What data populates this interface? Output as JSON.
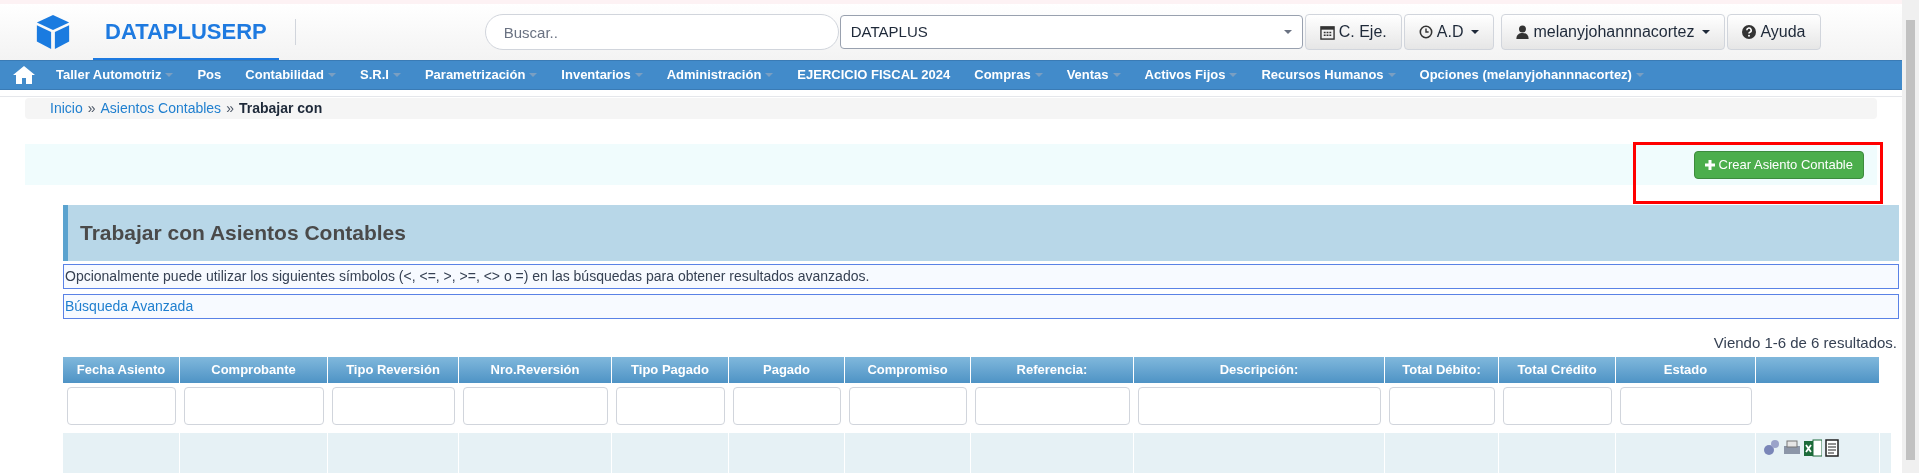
{
  "header": {
    "brand": "DATAPLUSERP",
    "search": {
      "placeholder": "Buscar.."
    },
    "company_select": {
      "value": "DATAPLUS"
    },
    "buttons": [
      {
        "kind": "calendar",
        "label": "C. Eje.",
        "dropdown": false
      },
      {
        "kind": "clock",
        "label": "A.D",
        "dropdown": true
      },
      {
        "kind": "user",
        "label": "melanyjohannnacortez",
        "dropdown": true
      },
      {
        "kind": "help",
        "label": "Ayuda",
        "dropdown": false
      }
    ]
  },
  "nav": {
    "items": [
      {
        "label": "Taller Automotriz",
        "dropdown": true
      },
      {
        "label": "Pos",
        "dropdown": false
      },
      {
        "label": "Contabilidad",
        "dropdown": true
      },
      {
        "label": "S.R.I",
        "dropdown": true
      },
      {
        "label": "Parametrización",
        "dropdown": true
      },
      {
        "label": "Inventarios",
        "dropdown": true
      },
      {
        "label": "Administración",
        "dropdown": true
      },
      {
        "label": "EJERCICIO FISCAL 2024",
        "dropdown": false
      },
      {
        "label": "Compras",
        "dropdown": true
      },
      {
        "label": "Ventas",
        "dropdown": true
      },
      {
        "label": "Activos Fijos",
        "dropdown": true
      },
      {
        "label": "Recursos Humanos",
        "dropdown": true
      },
      {
        "label": "Opciones (melanyjohannnacortez)",
        "dropdown": true
      }
    ]
  },
  "breadcrumb": [
    {
      "label": "Inicio",
      "link": true,
      "separator": "»"
    },
    {
      "label": "Asientos Contables",
      "link": true,
      "separator": "»"
    },
    {
      "label": "Trabajar con",
      "link": false
    }
  ],
  "create_button": {
    "label": "Crear Asiento Contable",
    "highlighted": true
  },
  "panel": {
    "title": "Trabajar con Asientos Contables",
    "hint": "Opcionalmente puede utilizar los siguientes símbolos (<, <=, >, >=, <> o =) en las búsquedas para obtener resultados avanzados.",
    "advanced_search": "Búsqueda Avanzada"
  },
  "summary": "Viendo 1-6 de 6 resultados.",
  "table": {
    "columns": [
      {
        "label": "Fecha Asiento",
        "filter": true
      },
      {
        "label": "Comprobante",
        "filter": true
      },
      {
        "label": "Tipo Reversión",
        "filter": true
      },
      {
        "label": "Nro.Reversión",
        "filter": true
      },
      {
        "label": "Tipo Pagado",
        "filter": true
      },
      {
        "label": "Pagado",
        "filter": true
      },
      {
        "label": "Compromiso",
        "filter": true
      },
      {
        "label": "Referencia:",
        "filter": true
      },
      {
        "label": "Descripción:",
        "filter": true
      },
      {
        "label": "Total Débito:",
        "filter": true
      },
      {
        "label": "Total Crédito",
        "filter": true
      },
      {
        "label": "Estado",
        "filter": true
      },
      {}
    ]
  }
}
